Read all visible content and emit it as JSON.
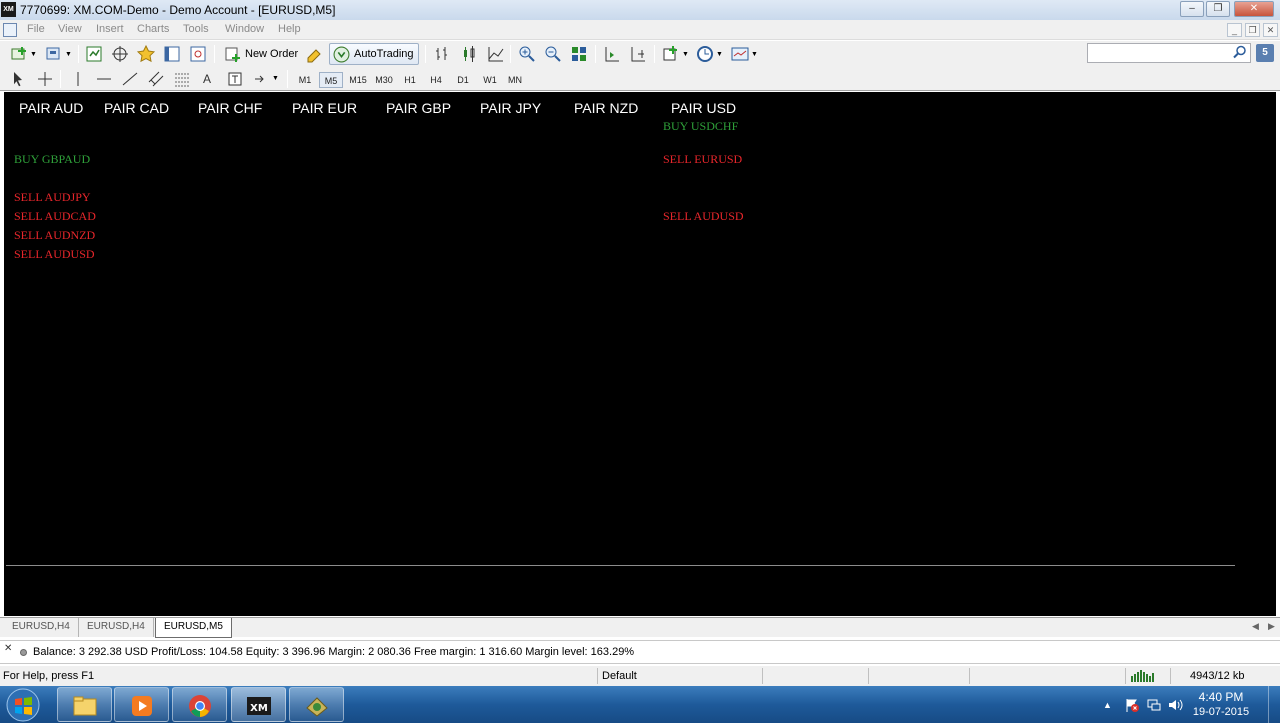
{
  "window": {
    "app_logo": "XM",
    "title": "7770699: XM.COM-Demo - Demo Account - [EURUSD,M5]"
  },
  "menu": {
    "items": [
      "File",
      "View",
      "Insert",
      "Charts",
      "Tools",
      "Window",
      "Help"
    ]
  },
  "toolbar": {
    "new_order_label": "New Order",
    "autotrading_label": "AutoTrading",
    "search_placeholder": "",
    "chat_label": "5"
  },
  "timeframes": {
    "items": [
      "M1",
      "M5",
      "M15",
      "M30",
      "H1",
      "H4",
      "D1",
      "W1",
      "MN"
    ],
    "selected": "M5"
  },
  "chart": {
    "pair_headers": [
      "PAIR AUD",
      "PAIR CAD",
      "PAIR CHF",
      "PAIR EUR",
      "PAIR GBP",
      "PAIR JPY",
      "PAIR NZD",
      "PAIR USD"
    ],
    "aud_signals": [
      {
        "text": "BUY GBPAUD",
        "type": "buy"
      },
      {
        "text": "SELL AUDJPY",
        "type": "sell"
      },
      {
        "text": "SELL AUDCAD",
        "type": "sell"
      },
      {
        "text": "SELL AUDNZD",
        "type": "sell"
      },
      {
        "text": "SELL AUDUSD",
        "type": "sell"
      }
    ],
    "usd_signals": [
      {
        "text": "BUY USDCHF",
        "type": "buy"
      },
      {
        "text": "SELL EURUSD",
        "type": "sell"
      },
      {
        "text": "SELL AUDUSD",
        "type": "sell"
      }
    ],
    "colors": {
      "background": "#000000",
      "buy": "#2fa13a",
      "sell": "#e8262b",
      "header": "#ffffff"
    }
  },
  "chart_tabs": {
    "tabs": [
      "EURUSD,H4",
      "EURUSD,H4",
      "EURUSD,M5"
    ],
    "active": "EURUSD,M5"
  },
  "terminal": {
    "balance_line": "Balance: 3 292.38 USD  Profit/Loss: 104.58  Equity: 3 396.96  Margin: 2 080.36  Free margin: 1 316.60  Margin level: 163.29%"
  },
  "statusbar": {
    "help_text": "For Help, press F1",
    "profile": "Default",
    "traffic": "4943/12 kb"
  },
  "taskbar": {
    "apps": [
      "explorer",
      "media-player",
      "chrome",
      "xm-terminal",
      "app"
    ],
    "clock_time": "4:40 PM",
    "clock_date": "19-07-2015"
  }
}
